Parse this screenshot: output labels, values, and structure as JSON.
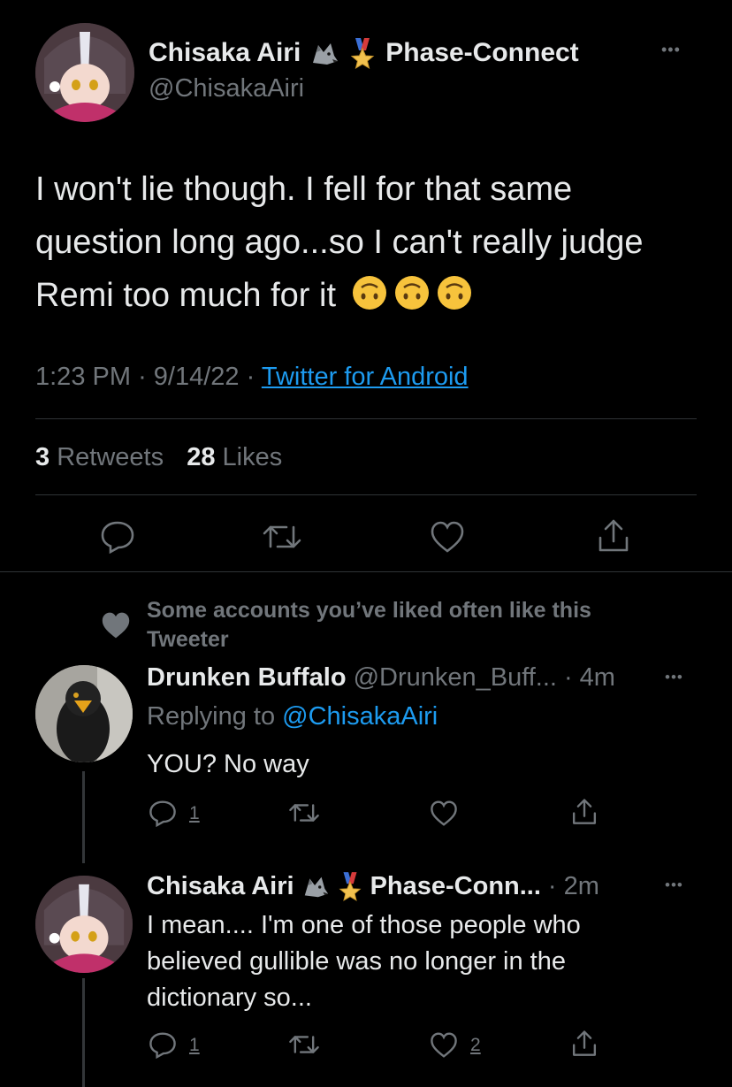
{
  "main_tweet": {
    "author_name": "Chisaka Airi",
    "author_badge_text": "Phase-Connect",
    "author_handle": "@ChisakaAiri",
    "more_label": "•••",
    "text": "I won't lie though. I fell for that same question long ago...so I can't really judge Remi too much for it",
    "emojis": [
      "upside-down-face-icon",
      "upside-down-face-icon",
      "upside-down-face-icon"
    ],
    "time": "1:23 PM",
    "sep": "·",
    "date": "9/14/22",
    "source": "Twitter for Android",
    "retweet_count": "3",
    "retweet_label": "Retweets",
    "like_count": "28",
    "like_label": "Likes"
  },
  "social_context": {
    "text": "Some accounts you’ve liked often like this Tweeter"
  },
  "reply1": {
    "author_name": "Drunken Buffalo",
    "author_handle": "@Drunken_Buff...",
    "sep": "·",
    "time": "4m",
    "more_label": "•••",
    "replying_prefix": "Replying to",
    "replying_handle": "@ChisakaAiri",
    "text": "YOU? No way",
    "reply_count": "1",
    "like_count": ""
  },
  "reply2": {
    "author_name": "Chisaka Airi",
    "author_badge_text": "Phase-Conn...",
    "sep": "·",
    "time": "2m",
    "more_label": "•••",
    "text": "I mean.... I'm one of those people who believed gullible was no longer in the dictionary so...",
    "reply_count": "1",
    "like_count": "2"
  },
  "colors": {
    "background": "#000000",
    "text_primary": "#e7e9ea",
    "text_muted": "#71767b",
    "link": "#1d9bf0",
    "divider": "#2f3336"
  }
}
